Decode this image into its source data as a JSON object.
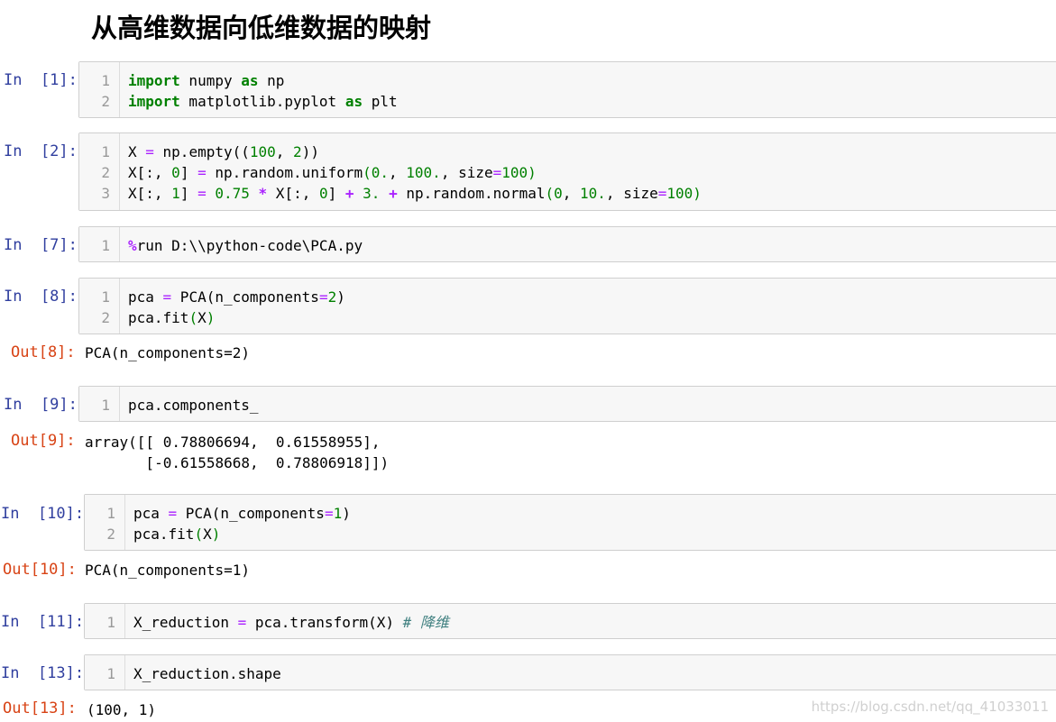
{
  "heading": "从高维数据向低维数据的映射",
  "cells": [
    {
      "prompt": "In  [1]:",
      "lines": [
        [
          [
            "kw",
            "import"
          ],
          [
            "t",
            " numpy "
          ],
          [
            "kw",
            "as"
          ],
          [
            "t",
            " np"
          ]
        ],
        [
          [
            "kw",
            "import"
          ],
          [
            "t",
            " matplotlib.pyplot "
          ],
          [
            "kw",
            "as"
          ],
          [
            "t",
            " plt"
          ]
        ]
      ]
    },
    {
      "prompt": "In  [2]:",
      "lines": [
        [
          [
            "t",
            "X "
          ],
          [
            "op",
            "="
          ],
          [
            "t",
            " np.empty"
          ],
          [
            "t",
            "(("
          ],
          [
            "num",
            "100"
          ],
          [
            "t",
            ", "
          ],
          [
            "num",
            "2"
          ],
          [
            "t",
            "))"
          ]
        ],
        [
          [
            "t",
            "X[:, "
          ],
          [
            "num",
            "0"
          ],
          [
            "t",
            "] "
          ],
          [
            "op",
            "="
          ],
          [
            "t",
            " np.random.uniform"
          ],
          [
            "par",
            "("
          ],
          [
            "num",
            "0."
          ],
          [
            "t",
            ", "
          ],
          [
            "num",
            "100."
          ],
          [
            "t",
            ", size"
          ],
          [
            "op",
            "="
          ],
          [
            "num",
            "100"
          ],
          [
            "par",
            ")"
          ]
        ],
        [
          [
            "t",
            "X[:, "
          ],
          [
            "num",
            "1"
          ],
          [
            "t",
            "] "
          ],
          [
            "op",
            "="
          ],
          [
            "t",
            " "
          ],
          [
            "num",
            "0.75"
          ],
          [
            "t",
            " "
          ],
          [
            "opb",
            "*"
          ],
          [
            "t",
            " X[:, "
          ],
          [
            "num",
            "0"
          ],
          [
            "t",
            "] "
          ],
          [
            "opb",
            "+"
          ],
          [
            "t",
            " "
          ],
          [
            "num",
            "3."
          ],
          [
            "t",
            " "
          ],
          [
            "opb",
            "+"
          ],
          [
            "t",
            " np.random.normal"
          ],
          [
            "par",
            "("
          ],
          [
            "num",
            "0"
          ],
          [
            "t",
            ", "
          ],
          [
            "num",
            "10."
          ],
          [
            "t",
            ", size"
          ],
          [
            "op",
            "="
          ],
          [
            "num",
            "100"
          ],
          [
            "par",
            ")"
          ]
        ]
      ]
    },
    {
      "prompt": "In  [7]:",
      "lines": [
        [
          [
            "mag",
            "%"
          ],
          [
            "t",
            "run D:\\\\python-code\\PCA.py"
          ]
        ]
      ]
    },
    {
      "prompt": "In  [8]:",
      "lines": [
        [
          [
            "t",
            "pca "
          ],
          [
            "op",
            "="
          ],
          [
            "t",
            " PCA(n_components"
          ],
          [
            "op",
            "="
          ],
          [
            "num",
            "2"
          ],
          [
            "t",
            ")"
          ]
        ],
        [
          [
            "t",
            "pca.fit"
          ],
          [
            "par",
            "("
          ],
          [
            "t",
            "X"
          ],
          [
            "par",
            ")"
          ]
        ]
      ],
      "out_prompt": "Out[8]:",
      "output": "PCA(n_components=2)"
    },
    {
      "prompt": "In  [9]:",
      "lines": [
        [
          [
            "t",
            "pca.components_"
          ]
        ]
      ],
      "out_prompt": "Out[9]:",
      "output": "array([[ 0.78806694,  0.61558955],\n       [-0.61558668,  0.78806918]])"
    },
    {
      "prompt": "In  [10]:",
      "lines": [
        [
          [
            "t",
            "pca "
          ],
          [
            "op",
            "="
          ],
          [
            "t",
            " PCA(n_components"
          ],
          [
            "op",
            "="
          ],
          [
            "num",
            "1"
          ],
          [
            "t",
            ")"
          ]
        ],
        [
          [
            "t",
            "pca.fit"
          ],
          [
            "par",
            "("
          ],
          [
            "t",
            "X"
          ],
          [
            "par",
            ")"
          ]
        ]
      ],
      "out_prompt": "Out[10]:",
      "output": "PCA(n_components=1)"
    },
    {
      "prompt": "In  [11]:",
      "lines": [
        [
          [
            "t",
            "X_reduction "
          ],
          [
            "op",
            "="
          ],
          [
            "t",
            " pca.transform(X) "
          ],
          [
            "cm",
            "# 降维"
          ]
        ]
      ]
    },
    {
      "prompt": "In  [13]:",
      "lines": [
        [
          [
            "t",
            "X_reduction.shape"
          ]
        ]
      ],
      "out_prompt": "Out[13]:",
      "output": "(100, 1)"
    }
  ],
  "watermark": "https://blog.csdn.net/qq_41033011"
}
